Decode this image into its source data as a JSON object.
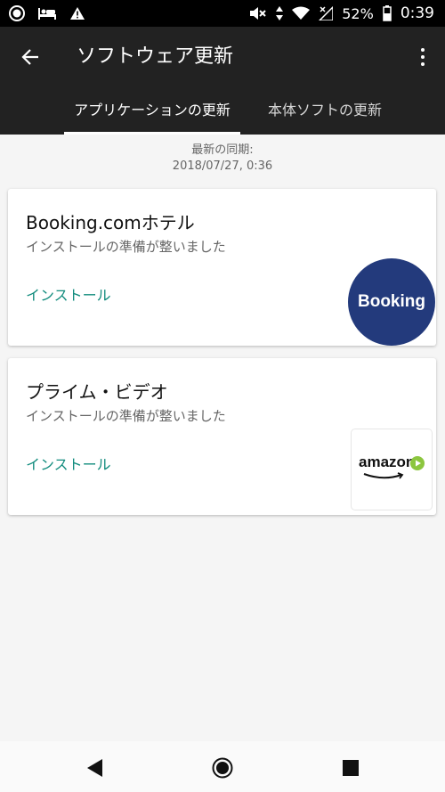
{
  "status_bar": {
    "battery": "52%",
    "time": "0:39",
    "icons": [
      "record-icon",
      "bed-icon",
      "warning-icon",
      "mute-icon",
      "data-arrows-icon",
      "wifi-icon",
      "signal-icon",
      "battery-icon"
    ]
  },
  "app_bar": {
    "title": "ソフトウェア更新",
    "back_icon": "arrow-left-icon",
    "menu_icon": "more-vert-icon",
    "tabs": [
      {
        "label": "アプリケーションの更新",
        "active": true
      },
      {
        "label": "本体ソフトの更新",
        "active": false
      }
    ]
  },
  "sync": {
    "label": "最新の同期:",
    "datetime": "2018/07/27, 0:36"
  },
  "updates": [
    {
      "name": "Booking.comホテル",
      "status": "インストールの準備が整いました",
      "action": "インストール",
      "logo_text": "Booking",
      "logo_color": "#233a7c"
    },
    {
      "name": "プライム・ビデオ",
      "status": "インストールの準備が整いました",
      "action": "インストール",
      "logo_text": "amazon",
      "logo_color": "#8cc63f"
    }
  ],
  "nav_bar": {
    "icons": [
      "back-triangle-icon",
      "home-circle-icon",
      "recents-square-icon"
    ]
  },
  "colors": {
    "app_bar": "#222222",
    "accent": "#128c7e",
    "background": "#f5f5f5"
  }
}
